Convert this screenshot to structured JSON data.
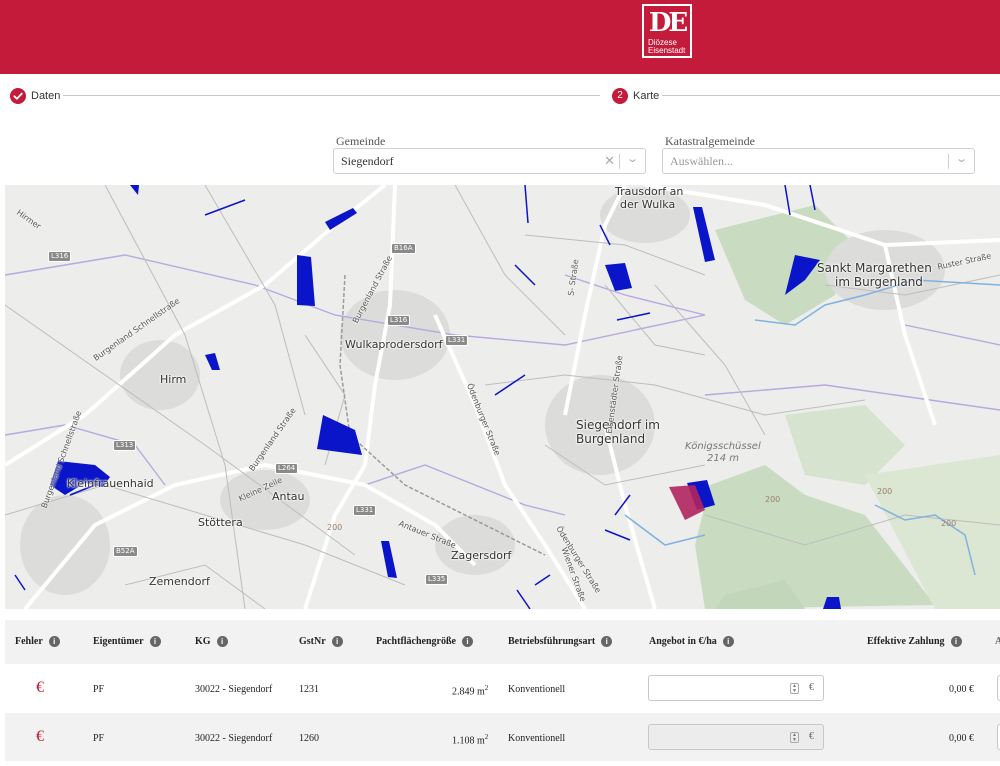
{
  "brand": {
    "monogram": "DE",
    "line1": "Diözese",
    "line2": "Eisenstadt"
  },
  "steps": [
    {
      "label": "Daten",
      "state": "done",
      "icon": "check-icon"
    },
    {
      "label": "Karte",
      "number": "2",
      "state": "active"
    }
  ],
  "filters": {
    "gemeinde": {
      "label": "Gemeinde",
      "value": "Siegendorf"
    },
    "katastralgemeinde": {
      "label": "Katastralgemeinde",
      "placeholder": "Auswählen..."
    }
  },
  "map": {
    "places": {
      "siegendorf": [
        "Siegendorf im",
        "Burgenland"
      ],
      "margarethen": [
        "Sankt Margarethen",
        "im Burgenland"
      ],
      "wulkaprodersdorf": "Wulkaprodersdorf",
      "trausdorf": [
        "Trausdorf an",
        "der Wulka"
      ],
      "himm": "Hirm",
      "kleinfrauenhaid": "Kleinfrauenhaid",
      "antau": "Antau",
      "stoettera": "Stöttera",
      "zagersdorf": "Zagersdorf",
      "zemendorf": "Zemendorf"
    },
    "hill": {
      "name": "Königsschüssel",
      "elevation": "214 m"
    },
    "contours": [
      "200",
      "200",
      "200",
      "200"
    ],
    "streets": {
      "burgenland_strasse": "Burgenland Straße",
      "burgenland_schnellstrasse": "Burgenland Schnellstraße",
      "oedenburger_strasse": "Ödenburger Straße",
      "eisenstaedter_strasse": "Eisenstädter Straße",
      "antauer_strasse": "Antauer Straße",
      "wiener_strasse": "Wiener Straße",
      "ruster_strasse": "Ruster Straße",
      "kleine_zeile": "Kleine Zeile",
      "hirmer": "Hirmer",
      "s_strasse": "S- Straße"
    },
    "shields": [
      "B16A",
      "L316",
      "L316",
      "L313",
      "L264",
      "L331",
      "L335",
      "B52A",
      "L331"
    ]
  },
  "table": {
    "columns": [
      "Fehler",
      "Eigentümer",
      "KG",
      "GstNr",
      "Pachtflächengröße",
      "Betriebsführungsart",
      "Angebot in €/ha",
      "Effektive Zahlung"
    ],
    "rows": [
      {
        "error_icon": "€",
        "eigentuemer": "PF",
        "kg": "30022 - Siegendorf",
        "gstnr": "1231",
        "flaeche": "2.849 m",
        "flaeche_unit_sup": "2",
        "art": "Konventionell",
        "angebot": "",
        "waehrung": "€",
        "zahlung": "0,00 €",
        "disabled": false
      },
      {
        "error_icon": "€",
        "eigentuemer": "PF",
        "kg": "30022 - Siegendorf",
        "gstnr": "1260",
        "flaeche": "1.108 m",
        "flaeche_unit_sup": "2",
        "art": "Konventionell",
        "angebot": "",
        "waehrung": "€",
        "zahlung": "0,00 €",
        "disabled": true
      }
    ]
  },
  "colors": {
    "brand": "#c41b3a",
    "parcel": "#0a14c8",
    "parcel_selected": "#b0245e",
    "forest": "#c9dcc1",
    "water": "#7fb2e0"
  }
}
